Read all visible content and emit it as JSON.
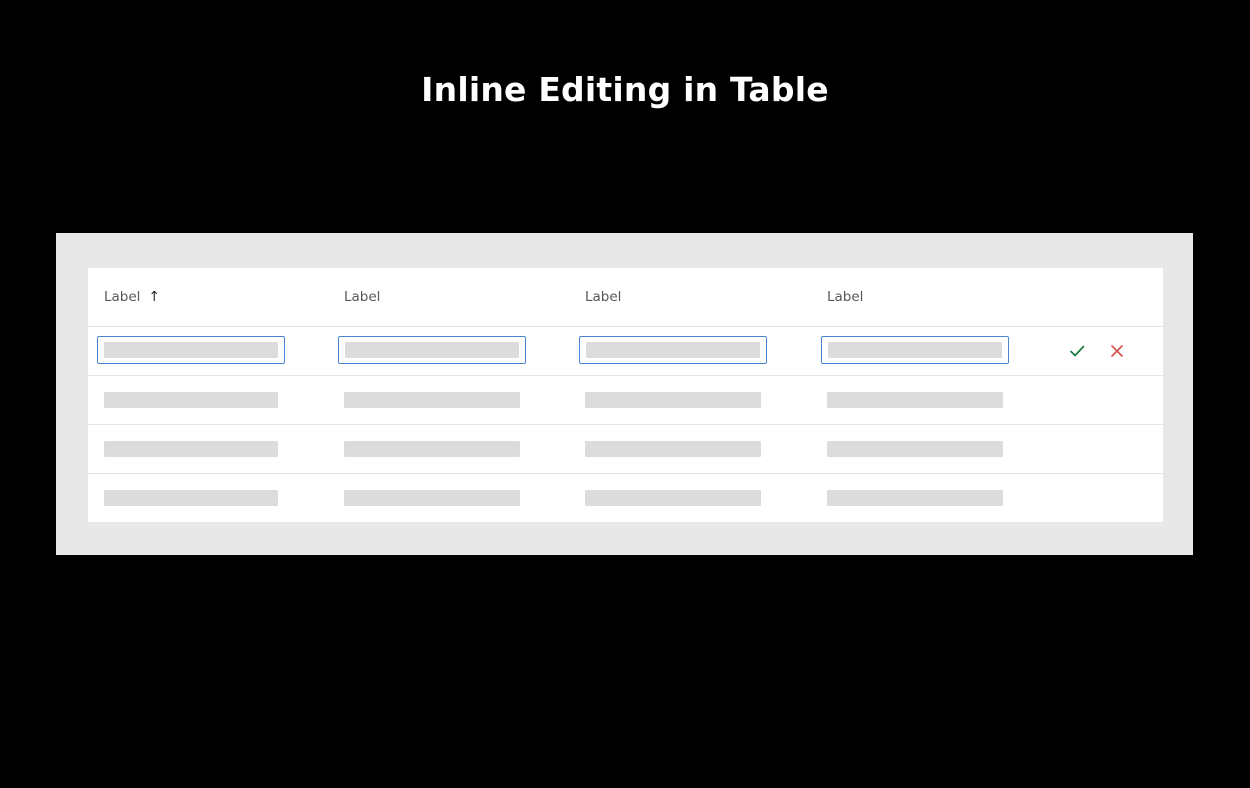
{
  "page": {
    "title": "Inline Editing in Table",
    "background_color": "#000000",
    "panel_color": "#e8e8e8",
    "card_color": "#ffffff"
  },
  "table": {
    "columns": [
      {
        "label": "Label",
        "sorted": true,
        "sort_icon": "arrow-up-icon",
        "sort_glyph": "↑"
      },
      {
        "label": "Label",
        "sorted": false
      },
      {
        "label": "Label",
        "sorted": false
      },
      {
        "label": "Label",
        "sorted": false
      }
    ],
    "editing_row": {
      "inputs": [
        {
          "value": "",
          "placeholder": ""
        },
        {
          "value": "",
          "placeholder": ""
        },
        {
          "value": "",
          "placeholder": ""
        },
        {
          "value": "",
          "placeholder": ""
        }
      ],
      "focus_border_color": "#4a86d0",
      "actions": [
        {
          "name": "confirm",
          "icon": "check-icon",
          "color": "#1a7a3e"
        },
        {
          "name": "cancel",
          "icon": "close-icon",
          "color": "#d9534f"
        }
      ]
    },
    "placeholder_rows": [
      {
        "cells": [
          "",
          "",
          "",
          ""
        ]
      },
      {
        "cells": [
          "",
          "",
          "",
          ""
        ]
      },
      {
        "cells": [
          "",
          "",
          "",
          ""
        ]
      }
    ],
    "skeleton_color": "#dcdcdc",
    "divider_color": "#e4e4e4"
  }
}
